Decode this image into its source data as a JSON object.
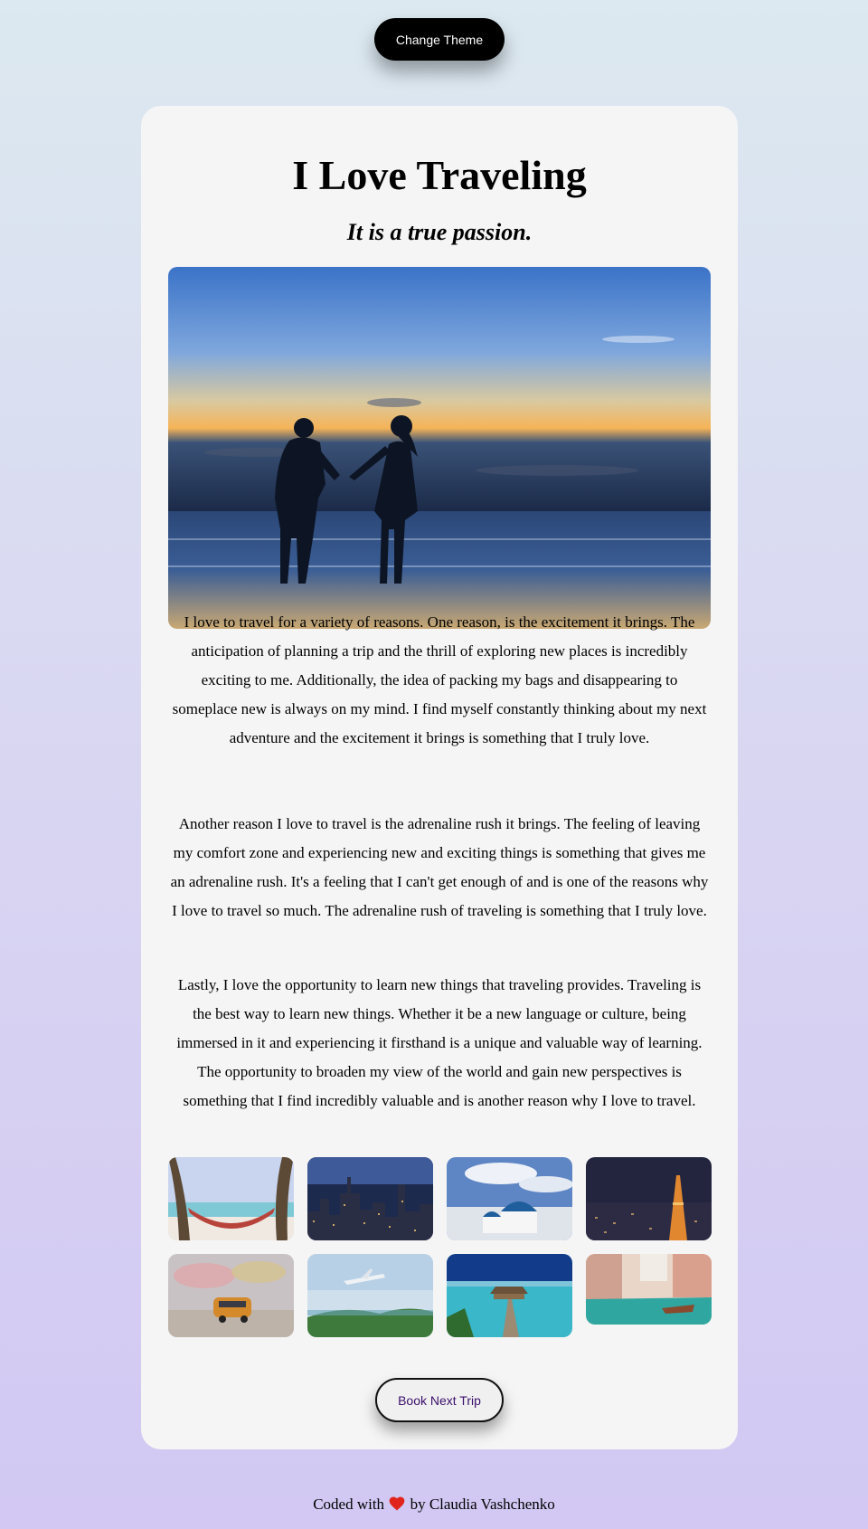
{
  "header": {
    "theme_button": "Change Theme"
  },
  "card": {
    "title": "I Love Traveling",
    "subtitle": "It is a true passion.",
    "hero_image": "couple-beach-sunset-photo",
    "paragraphs": [
      "I love to travel for a variety of reasons. One reason, is the excitement it brings. The anticipation of planning a trip and the thrill of exploring new places is incredibly exciting to me. Additionally, the idea of packing my bags and disappearing to someplace new is always on my mind. I find myself constantly thinking about my next adventure and the excitement it brings is something that I truly love.",
      "Another reason I love to travel is the adrenaline rush it brings. The feeling of leaving my comfort zone and experiencing new and exciting things is something that gives me an adrenaline rush. It's a feeling that I can't get enough of and is one of the reasons why I love to travel so much. The adrenaline rush of traveling is something that I truly love.",
      "Lastly, I love the opportunity to learn new things that traveling provides. Traveling is the best way to learn new things. Whether it be a new language or culture, being immersed in it and experiencing it firsthand is a unique and valuable way of learning. The opportunity to broaden my view of the world and gain new perspectives is something that I find incredibly valuable and is another reason why I love to travel."
    ],
    "gallery": [
      "hammock-beach-photo",
      "city-skyline-night-photo",
      "santorini-domes-photo",
      "tokyo-tower-night-photo",
      "toy-van-photo",
      "airplane-island-photo",
      "overwater-bungalow-pier-photo",
      "venice-canal-photo"
    ],
    "book_button": "Book Next Trip"
  },
  "footer": {
    "prefix": "Coded with",
    "heart_icon": "heart-icon",
    "suffix": "by Claudia Vashchenko"
  },
  "colors": {
    "card_bg": "#f5f5f5",
    "theme_button_bg": "#000000",
    "book_button_text": "#3b0f6b",
    "heart": "#e0241b"
  }
}
